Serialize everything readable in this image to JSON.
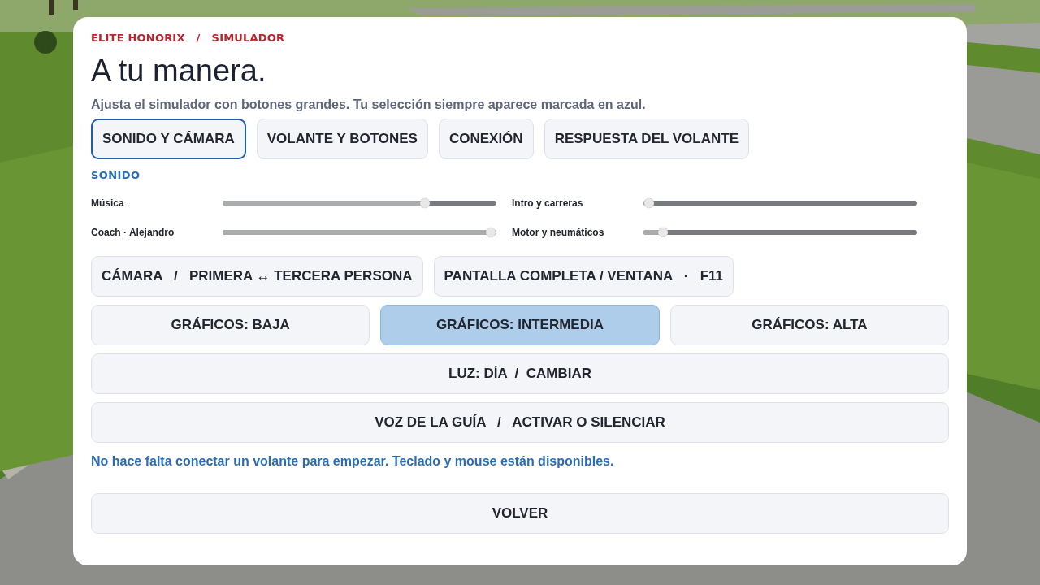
{
  "breadcrumb": [
    "ELITE HONORIX",
    "/",
    "SIMULADOR"
  ],
  "title": "A tu manera.",
  "subtitle": "Ajusta el simulador con botones grandes. Tu selección siempre aparece marcada en azul.",
  "tabs": [
    {
      "label": "SONIDO Y CÁMARA",
      "selected": true
    },
    {
      "label": "VOLANTE Y BOTONES",
      "selected": false
    },
    {
      "label": "CONEXIÓN",
      "selected": false
    },
    {
      "label": "RESPUESTA DEL VOLANTE",
      "selected": false
    }
  ],
  "section_label": "SONIDO",
  "sliders": [
    {
      "name": "Música",
      "level": 0.74
    },
    {
      "name": "Intro y carreras",
      "level": 0.02
    },
    {
      "name": "Coach · Alejandro",
      "level": 0.98
    },
    {
      "name": "Motor y neumáticos",
      "level": 0.07
    }
  ],
  "toggles": [
    "CÁMARA   /   PRIMERA ↔ TERCERA PERSONA",
    "PANTALLA COMPLETA / VENTANA   ·   F11"
  ],
  "graphics": [
    {
      "label": "GRÁFICOS: BAJA",
      "selected": false
    },
    {
      "label": "GRÁFICOS: INTERMEDIA",
      "selected": true
    },
    {
      "label": "GRÁFICOS: ALTA",
      "selected": false
    }
  ],
  "wide_buttons": [
    "LUZ: DÍA  /  CAMBIAR",
    "VOZ DE LA GUÍA   /   ACTIVAR O SILENCIAR"
  ],
  "note": "No hace falta conectar un volante para empezar. Teclado y mouse están disponibles.",
  "back_button": "VOLVER"
}
